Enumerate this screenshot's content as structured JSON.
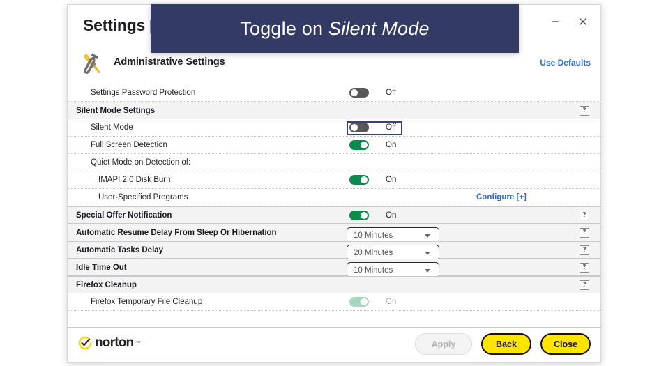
{
  "overlay": {
    "text_plain": "Toggle on ",
    "text_emphasis": "Silent Mode",
    "bg_color": "#333a63"
  },
  "window": {
    "title": "Settings",
    "title_suffix": "[",
    "minimize_icon": "minimize-icon",
    "close_icon": "close-icon"
  },
  "header": {
    "icon": "wrench-screwdriver-icon",
    "title": "Administrative Settings",
    "use_defaults_label": "Use Defaults",
    "link_color": "#2f6fd0"
  },
  "rows": [
    {
      "label": "Settings Password Protection",
      "indent": 1,
      "type": "toggle",
      "toggle_state": "off",
      "state_label": "Off",
      "section": false,
      "help": false,
      "focused": false
    },
    {
      "label": "Silent Mode Settings",
      "indent": 0,
      "type": "none",
      "section": true,
      "help": true
    },
    {
      "label": "Silent Mode",
      "indent": 1,
      "type": "toggle",
      "toggle_state": "off",
      "state_label": "Off",
      "section": false,
      "help": false,
      "focused": true
    },
    {
      "label": "Full Screen Detection",
      "indent": 1,
      "type": "toggle",
      "toggle_state": "on",
      "state_label": "On",
      "section": false,
      "help": false,
      "focused": false
    },
    {
      "label": "Quiet Mode on Detection of:",
      "indent": 1,
      "type": "none",
      "section": false,
      "help": false
    },
    {
      "label": "IMAPI 2.0 Disk Burn",
      "indent": 2,
      "type": "toggle",
      "toggle_state": "on",
      "state_label": "On",
      "section": false,
      "help": false,
      "focused": false
    },
    {
      "label": "User-Specified Programs",
      "indent": 2,
      "type": "link",
      "link_label": "Configure [+]",
      "section": false,
      "help": false
    },
    {
      "label": "Special Offer Notification",
      "indent": 0,
      "type": "toggle",
      "toggle_state": "on",
      "state_label": "On",
      "section": true,
      "help": true,
      "focused": false
    },
    {
      "label": "Automatic Resume Delay From Sleep Or Hibernation",
      "indent": 0,
      "type": "select",
      "select_value": "10 Minutes",
      "section": true,
      "help": true
    },
    {
      "label": "Automatic Tasks Delay",
      "indent": 0,
      "type": "select",
      "select_value": "20 Minutes",
      "section": true,
      "help": true
    },
    {
      "label": "Idle Time Out",
      "indent": 0,
      "type": "select",
      "select_value": "10 Minutes",
      "section": true,
      "help": true
    },
    {
      "label": "Firefox Cleanup",
      "indent": 0,
      "type": "none",
      "section": true,
      "help": true
    },
    {
      "label": "Firefox Temporary File Cleanup",
      "indent": 1,
      "type": "toggle",
      "toggle_state": "dim",
      "state_label": "On",
      "section": false,
      "help": false,
      "focused": false
    }
  ],
  "help_glyph": "?",
  "footer": {
    "brand": "norton",
    "brand_tm": "™",
    "buttons": [
      {
        "label": "Apply",
        "style": "apply"
      },
      {
        "label": "Back",
        "style": "yellow"
      },
      {
        "label": "Close",
        "style": "yellow"
      }
    ]
  },
  "colors": {
    "toggle_on": "#0a8a4d",
    "toggle_off": "#585858",
    "accent_yellow": "#ffe400",
    "section_bg": "#f3f3f3"
  }
}
